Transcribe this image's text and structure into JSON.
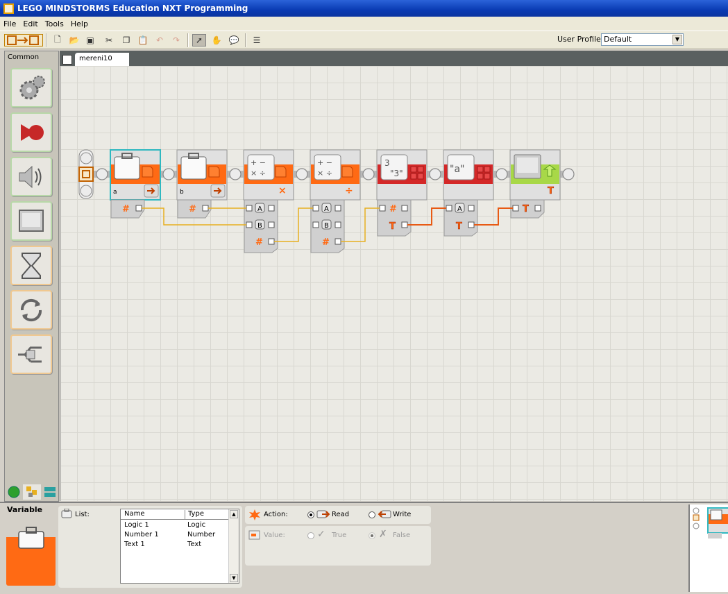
{
  "window": {
    "title": "LEGO MINDSTORMS Education NXT Programming"
  },
  "menu": {
    "file": "File",
    "edit": "Edit",
    "tools": "Tools",
    "help": "Help"
  },
  "toolbar": {
    "profile_label": "User Profile:",
    "profile_value": "Default"
  },
  "palette": {
    "title": "Common",
    "items": [
      "move",
      "record-play",
      "sound",
      "display",
      "wait",
      "loop",
      "switch"
    ]
  },
  "document": {
    "tab_label": "mereni10"
  },
  "program": {
    "blocks": [
      {
        "type": "variable",
        "label": "a",
        "selected": true
      },
      {
        "type": "variable",
        "label": "b"
      },
      {
        "type": "math",
        "op": "multiply"
      },
      {
        "type": "math",
        "op": "divide"
      },
      {
        "type": "number-to-text"
      },
      {
        "type": "text"
      },
      {
        "type": "display"
      }
    ],
    "plug_a": "A",
    "plug_b": "B",
    "num_sym": "#",
    "text_sym": "T"
  },
  "config": {
    "block_title": "Variable",
    "list_label": "List:",
    "columns": [
      "Name",
      "Type"
    ],
    "rows": [
      {
        "name": "Logic 1",
        "type": "Logic"
      },
      {
        "name": "Number 1",
        "type": "Number"
      },
      {
        "name": "Text 1",
        "type": "Text"
      }
    ],
    "action_label": "Action:",
    "read_label": "Read",
    "write_label": "Write",
    "action_selected": "Read",
    "value_label": "Value:",
    "true_label": "True",
    "false_label": "False"
  },
  "colors": {
    "accent": "#ff6a14",
    "data_wire_number": "#e8b020",
    "data_wire_text": "#e85a14",
    "block_red": "#d42828",
    "block_green": "#a8d848"
  }
}
